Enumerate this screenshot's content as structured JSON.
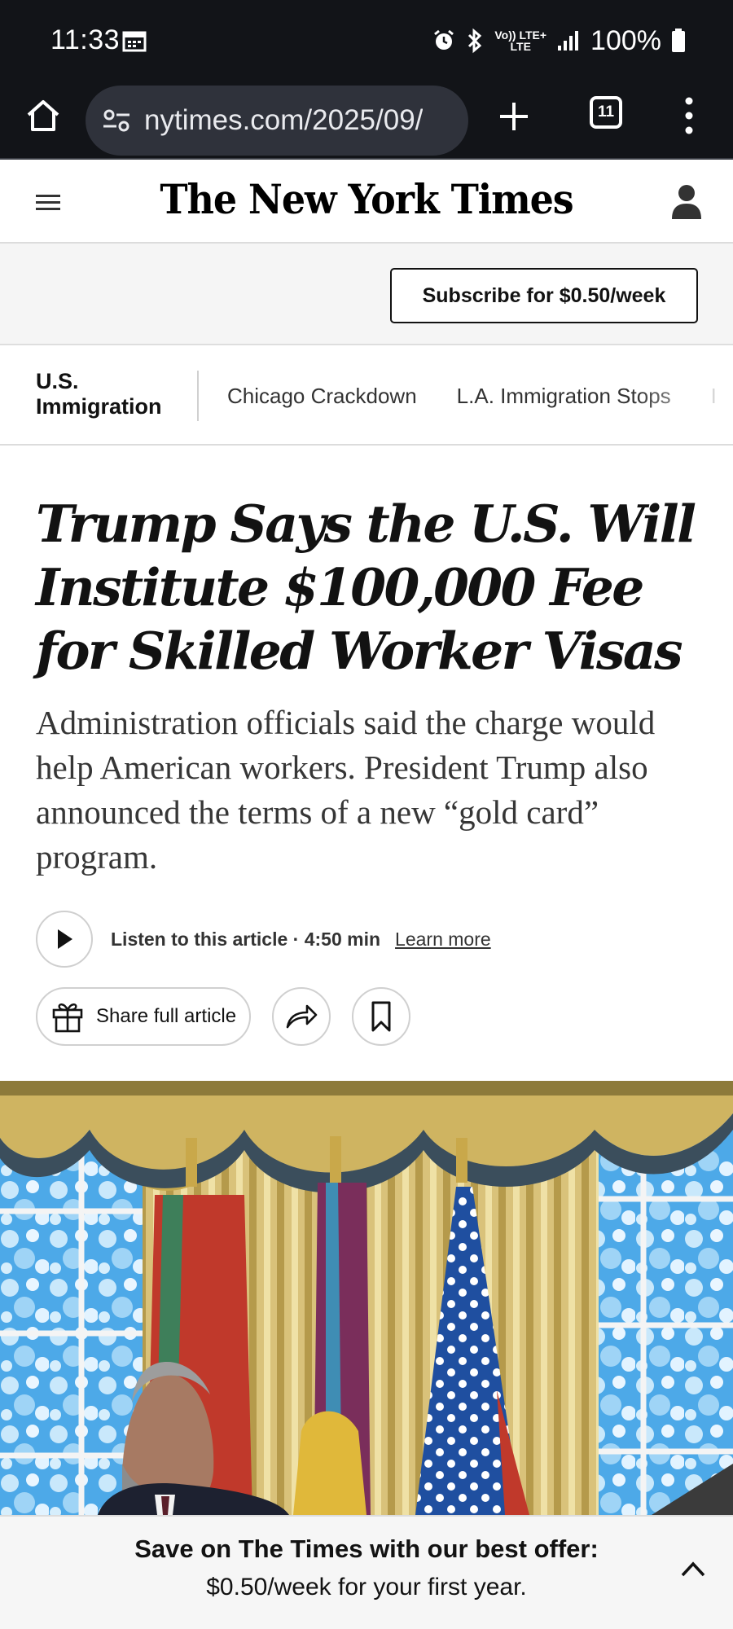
{
  "status_bar": {
    "time": "11:33",
    "net_top": "Vo)) LTE+",
    "net_bottom": "LTE",
    "battery": "100%"
  },
  "browser": {
    "url": "nytimes.com/2025/09/",
    "tab_count": "11"
  },
  "header": {
    "masthead": "The New York Times"
  },
  "subscribe": {
    "label": "Subscribe for $0.50/week"
  },
  "section_nav": {
    "section_line1": "U.S.",
    "section_line2": "Immigration",
    "links": [
      "Chicago Crackdown",
      "L.A. Immigration Stops",
      "I"
    ]
  },
  "article": {
    "headline": "Trump Says the U.S. Will Institute $100,000 Fee for Skilled Worker Visas",
    "summary": "Administration officials said the charge would help American workers. President Trump also announced the terms of a new “gold card” program.",
    "listen_label": "Listen to this article · 4:50 min",
    "learn_more": "Learn more",
    "share_full": "Share full article"
  },
  "offer": {
    "line1": "Save on The Times with our best offer:",
    "line2": "$0.50/week for your first year."
  },
  "colors": {
    "system_bar": "#121418",
    "url_pill": "#2f323b",
    "text": "#121212",
    "band": "#f5f5f5"
  }
}
